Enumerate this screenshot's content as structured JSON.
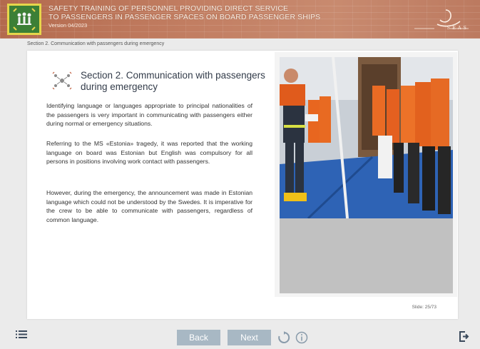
{
  "header": {
    "title_line1": "SAFETY TRAINING OF PERSONNEL PROVIDING DIRECT SERVICE",
    "title_line2": "TO PASSENGERS IN PASSENGER SPACES ON BOARD PASSENGER SHIPS",
    "version": "Version 04/2023",
    "brand_name": "SEAS"
  },
  "breadcrumb": "Section 2. Communication with passengers during emergency",
  "content": {
    "section_title": "Section 2. Communication with passengers during emergency",
    "paragraphs": [
      "Identifying language or languages appropriate to principal nationalities of the passengers is very important in communicating with passengers either during normal or emergency situations.",
      "Referring to the MS «Estonia» tragedy, it was reported that the working language on board was Estonian but English was compulsory for all persons in positions involving work contact with passengers.",
      "However, during the emergency, the announcement was made in Estonian language which could not be understood by the Swedes. It is imperative for the crew to be able to communicate with passengers, regardless of common language."
    ],
    "photo_description": "Crew member in firefighting gear addressing passengers wearing orange life jackets on deck",
    "slide_counter": "Slide: 25/73"
  },
  "footer": {
    "back_label": "Back",
    "next_label": "Next",
    "icons": {
      "menu": "list-menu-icon",
      "replay": "replay-icon",
      "info": "info-icon",
      "exit": "exit-icon"
    }
  },
  "colors": {
    "header_bg": "#c27e62",
    "logo_bg": "#3c7f36",
    "nav_button": "#a8b8c4",
    "title_text": "#333c4a"
  }
}
